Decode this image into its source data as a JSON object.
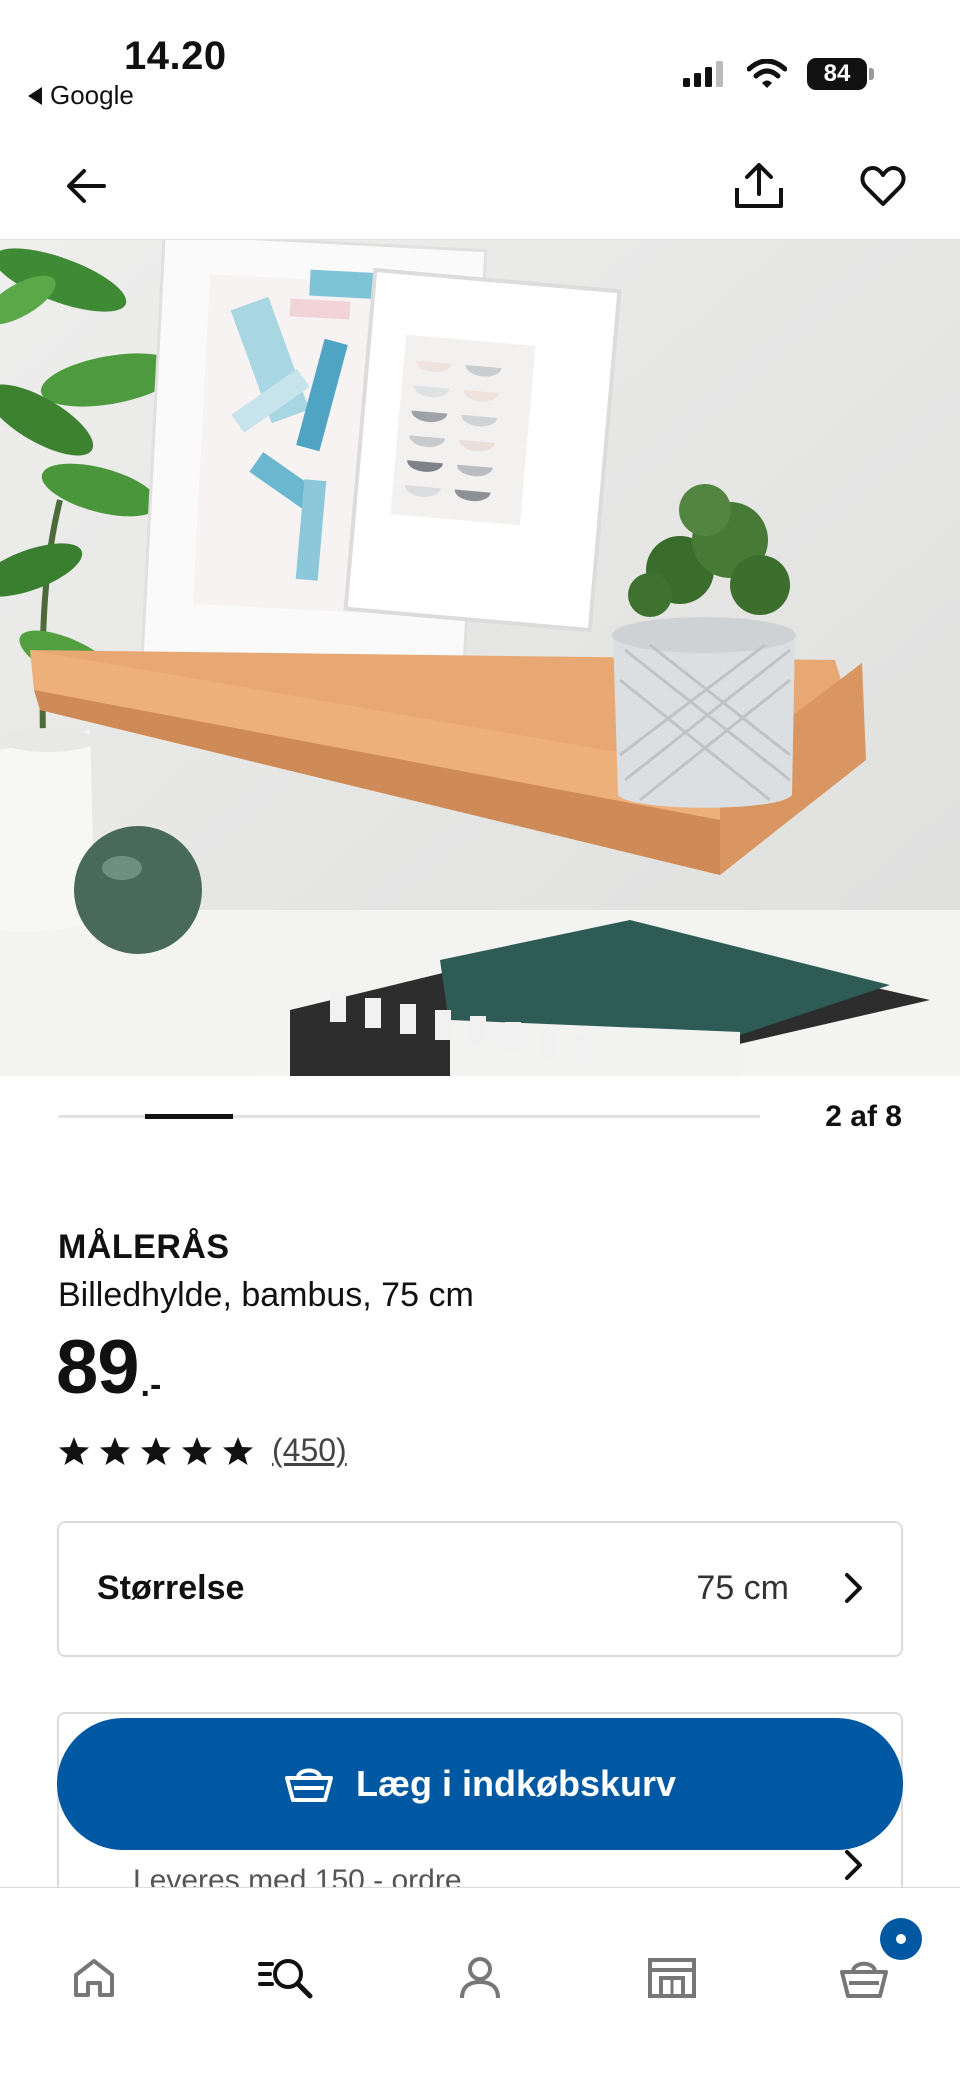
{
  "status_bar": {
    "time": "14.20",
    "back_app": "Google",
    "battery": "84"
  },
  "header": {
    "back_icon": "arrow-left-icon",
    "share_icon": "share-icon",
    "favorite_icon": "heart-icon"
  },
  "gallery": {
    "pager_label": "2 af 8",
    "current_index": 2,
    "total": 8
  },
  "product": {
    "name": "MÅLERÅS",
    "description": "Billedhylde, bambus, 75 cm",
    "price_integer": "89",
    "price_suffix": ".-",
    "rating_stars": 5,
    "review_count": "(450)"
  },
  "size_selector": {
    "label": "Størrelse",
    "value": "75 cm"
  },
  "cart_button": {
    "label": "Læg i indkøbskurv",
    "icon": "basket-icon"
  },
  "delivery": {
    "text": "Leveres med 150,- ordre"
  },
  "bottom_nav": {
    "items": [
      "home-icon",
      "search-list-icon",
      "profile-icon",
      "store-icon",
      "cart-icon"
    ]
  },
  "colors": {
    "brand_blue": "#0058a3",
    "shelf_bamboo": "#e5a470",
    "wall": "#e9e9e8"
  }
}
